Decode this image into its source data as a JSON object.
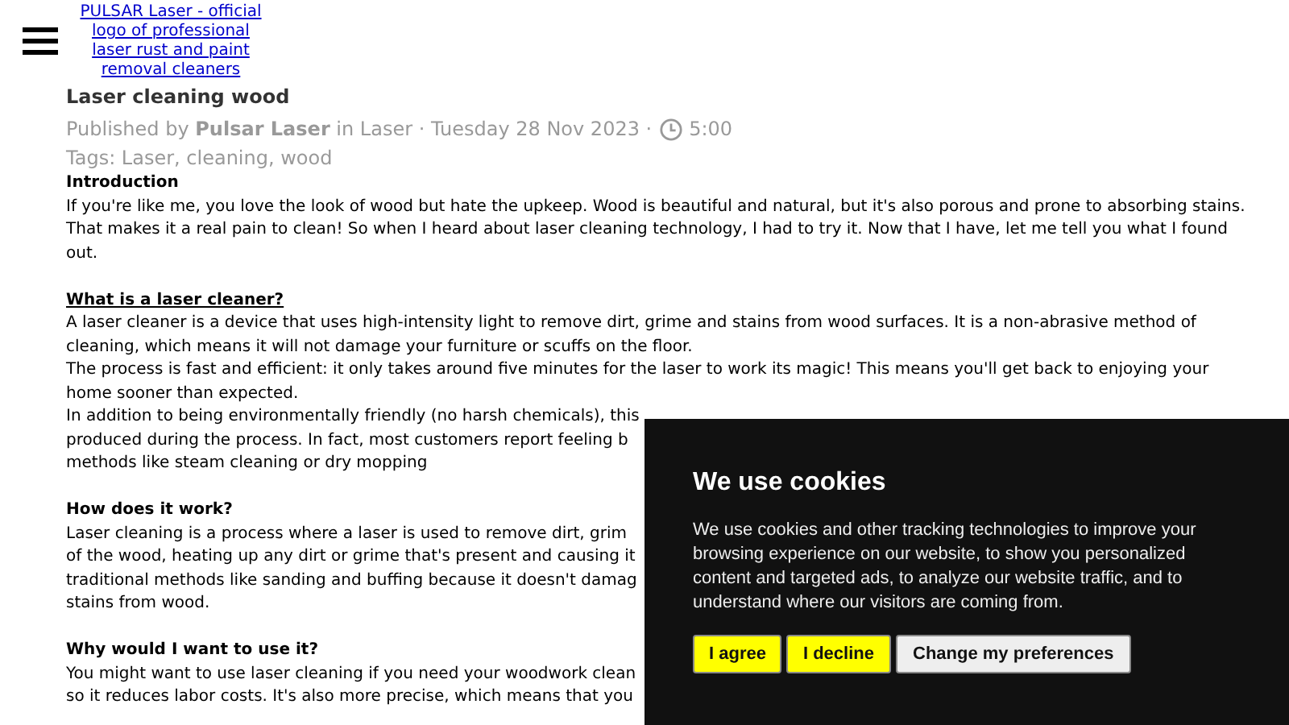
{
  "logo_link": {
    "text": "PULSAR Laser - official logo of professional laser rust and paint removal cleaners"
  },
  "article": {
    "title": "Laser cleaning wood",
    "meta": "Published by **Pulsar Laser** in Laser · Tuesday 28 Nov 2023 ·",
    "reading_time": "5:00",
    "tags": "Tags: Laser, cleaning, wood",
    "blocks": [
      {
        "kind": "heading",
        "text": "Introduction",
        "underlined": false
      },
      {
        "kind": "paragraph",
        "text": "If you're like me, you love the look of wood but hate the upkeep. Wood is beautiful and natural, but it's also porous and prone to absorbing stains. That makes it a real pain to clean! So when I heard about laser cleaning technology, I had to try it. Now that I have, let me tell you what I found out."
      },
      {
        "kind": "heading",
        "text": "What is a laser cleaner?",
        "underlined": true
      },
      {
        "kind": "paragraph",
        "text": "A laser cleaner is a device that uses high-intensity light to remove dirt, grime and stains from wood surfaces. It is a non-abrasive method of cleaning, which means it will not damage your furniture or scuffs on the floor."
      },
      {
        "kind": "paragraph",
        "text": "The process is fast and efficient: it only takes around five minutes for the laser to work its magic! This means you'll get back to enjoying your home sooner than expected."
      },
      {
        "kind": "lines",
        "lines": [
          "In addition to being environmentally friendly (no harsh chemicals), this",
          "produced during the process. In fact, most customers report feeling b",
          "methods like steam cleaning or dry mopping"
        ]
      },
      {
        "kind": "heading",
        "text": "How does it work?",
        "underlined": false
      },
      {
        "kind": "lines",
        "lines": [
          "Laser cleaning is a process where a laser is used to remove dirt, grim",
          "of the wood, heating up any dirt or grime that's present and causing it",
          "traditional methods like sanding and buffing because it doesn't damag",
          "stains from wood."
        ]
      },
      {
        "kind": "heading",
        "text": "Why would I want to use it?",
        "underlined": false
      },
      {
        "kind": "lines",
        "lines": [
          "You might want to use laser cleaning if you need your woodwork clean",
          "so it reduces labor costs. It's also more precise, which means that you"
        ]
      }
    ]
  },
  "cookie_banner": {
    "title": "We use cookies",
    "text": "We use cookies and other tracking technologies to improve your browsing experience on our website, to show you personalized content and targeted ads, to analyze our website traffic, and to understand where our visitors are coming from.",
    "buttons": [
      {
        "label": "I agree",
        "kind": "primary"
      },
      {
        "label": "I decline",
        "kind": "primary"
      },
      {
        "label": "Change my preferences",
        "kind": "secondary"
      }
    ]
  }
}
